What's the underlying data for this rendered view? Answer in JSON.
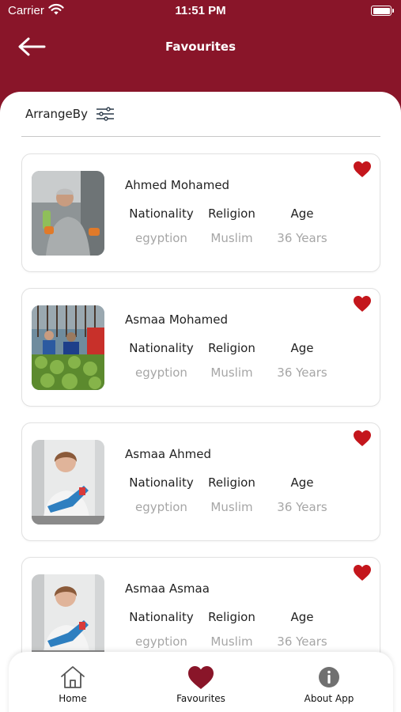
{
  "status_bar": {
    "carrier": "Carrier",
    "time": "11:51 PM"
  },
  "header": {
    "title": "Favourites"
  },
  "arrange": {
    "label": "ArrangeBy"
  },
  "columns": {
    "nationality": "Nationality",
    "religion": "Religion",
    "age": "Age"
  },
  "people": [
    {
      "name": "Ahmed Mohamed",
      "nationality": "egyption",
      "religion": "Muslim",
      "age": "36 Years"
    },
    {
      "name": "Asmaa Mohamed",
      "nationality": "egyption",
      "religion": "Muslim",
      "age": "36 Years"
    },
    {
      "name": "Asmaa Ahmed",
      "nationality": "egyption",
      "religion": "Muslim",
      "age": "36 Years"
    },
    {
      "name": "Asmaa Asmaa",
      "nationality": "egyption",
      "religion": "Muslim",
      "age": "36 Years"
    }
  ],
  "tabs": {
    "home": "Home",
    "favourites": "Favourites",
    "about": "About App"
  },
  "colors": {
    "brand": "#891529",
    "heart": "#c4161c",
    "muted": "#a6a6a6"
  }
}
